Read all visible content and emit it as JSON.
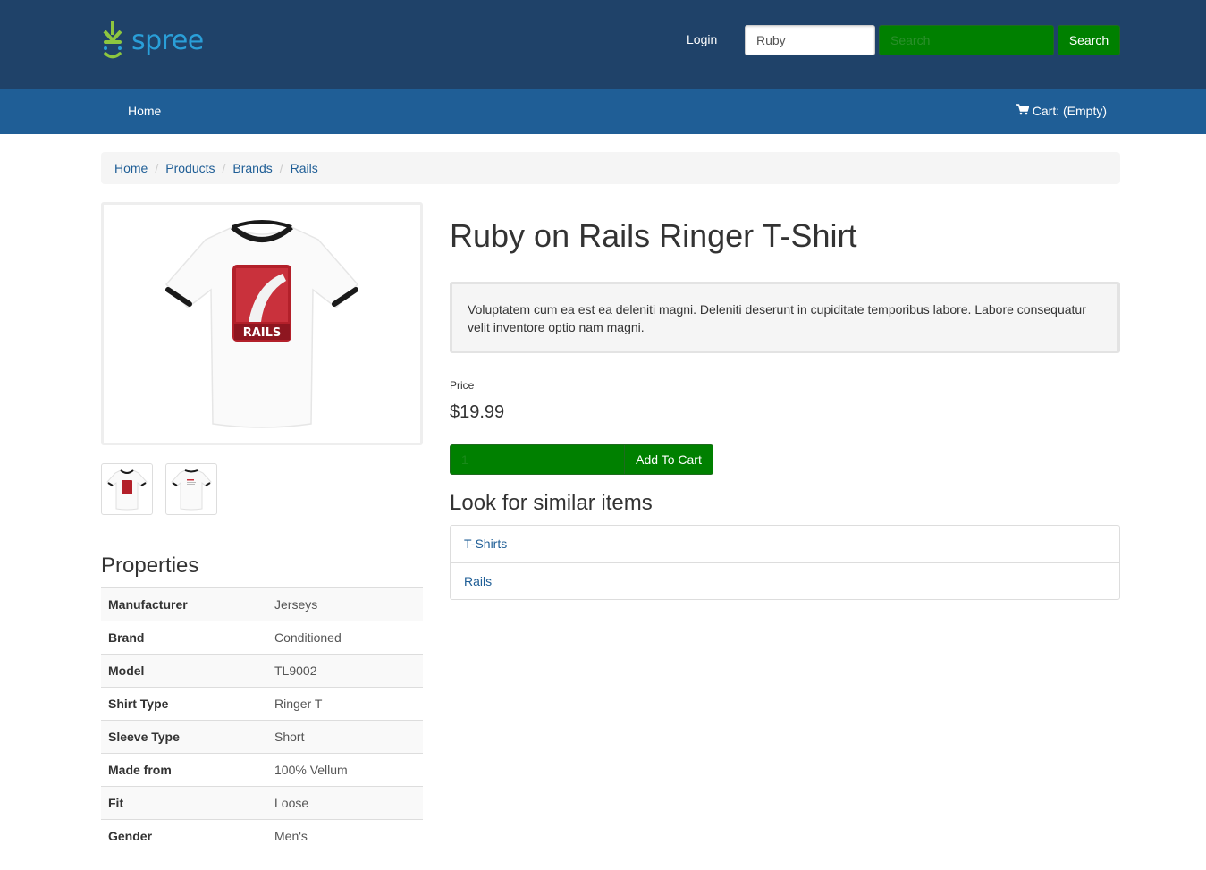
{
  "header": {
    "logo_text": "spree",
    "login_label": "Login",
    "taxon_select_value": "Ruby",
    "search_placeholder": "Search",
    "search_button_label": "Search"
  },
  "nav": {
    "home_label": "Home",
    "cart_label": "Cart: (Empty)"
  },
  "breadcrumb": [
    "Home",
    "Products",
    "Brands",
    "Rails"
  ],
  "product": {
    "title": "Ruby on Rails Ringer T-Shirt",
    "description": "Voluptatem cum ea est ea deleniti magni. Deleniti deserunt in cupiditate temporibus labore. Labore consequatur velit inventore optio nam magni.",
    "price_label": "Price",
    "price": "$19.99",
    "quantity": "1",
    "add_to_cart_label": "Add To Cart",
    "image_logo_text": "RAILS"
  },
  "similar": {
    "title": "Look for similar items",
    "items": [
      "T-Shirts",
      "Rails"
    ]
  },
  "properties": {
    "title": "Properties",
    "rows": [
      {
        "name": "Manufacturer",
        "value": "Jerseys"
      },
      {
        "name": "Brand",
        "value": "Conditioned"
      },
      {
        "name": "Model",
        "value": "TL9002"
      },
      {
        "name": "Shirt Type",
        "value": "Ringer T"
      },
      {
        "name": "Sleeve Type",
        "value": "Short"
      },
      {
        "name": "Made from",
        "value": "100% Vellum"
      },
      {
        "name": "Fit",
        "value": "Loose"
      },
      {
        "name": "Gender",
        "value": "Men's"
      }
    ]
  },
  "colors": {
    "header_bg": "#1f4269",
    "navbar_bg": "#1f5e96",
    "button_green": "#008000",
    "link_blue": "#1f5e96",
    "logo_green": "#8dc63f",
    "logo_blue": "#2a9fd8",
    "rails_red": "#b3202a"
  },
  "icons": [
    "spree-logo-icon",
    "cart-icon"
  ]
}
